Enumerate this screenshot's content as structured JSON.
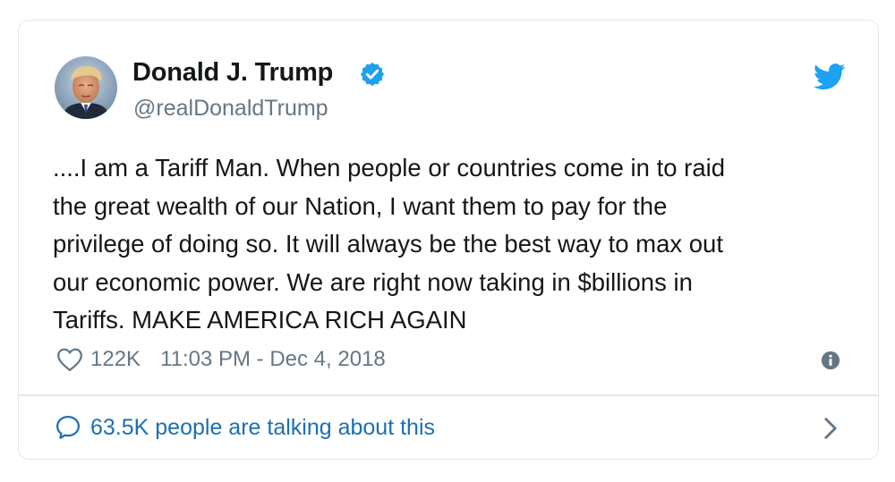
{
  "author": {
    "display_name": "Donald J. Trump",
    "handle": "@realDonaldTrump",
    "verified": true
  },
  "tweet": {
    "text": "....I am a Tariff Man. When people or countries come in to raid\nthe great wealth of our Nation, I want them to pay for the\nprivilege of doing so. It will always be the best way to max out\nour economic power. We are right now taking in $billions in\nTariffs. MAKE AMERICA RICH AGAIN",
    "likes": "122K",
    "timestamp": "11:03 PM - Dec 4, 2018"
  },
  "footer": {
    "talking_text": "63.5K people are talking about this"
  },
  "icons": {
    "brand": "twitter-bird-icon",
    "verified": "verified-badge-icon",
    "like": "heart-icon",
    "info": "info-icon",
    "reply": "speech-bubble-icon",
    "expand": "chevron-right-icon"
  },
  "colors": {
    "twitter_blue": "#1da1f2",
    "link_blue": "#1b6fb3",
    "muted_gray": "#657786",
    "border": "#e1e8ed",
    "text": "#14171a"
  }
}
